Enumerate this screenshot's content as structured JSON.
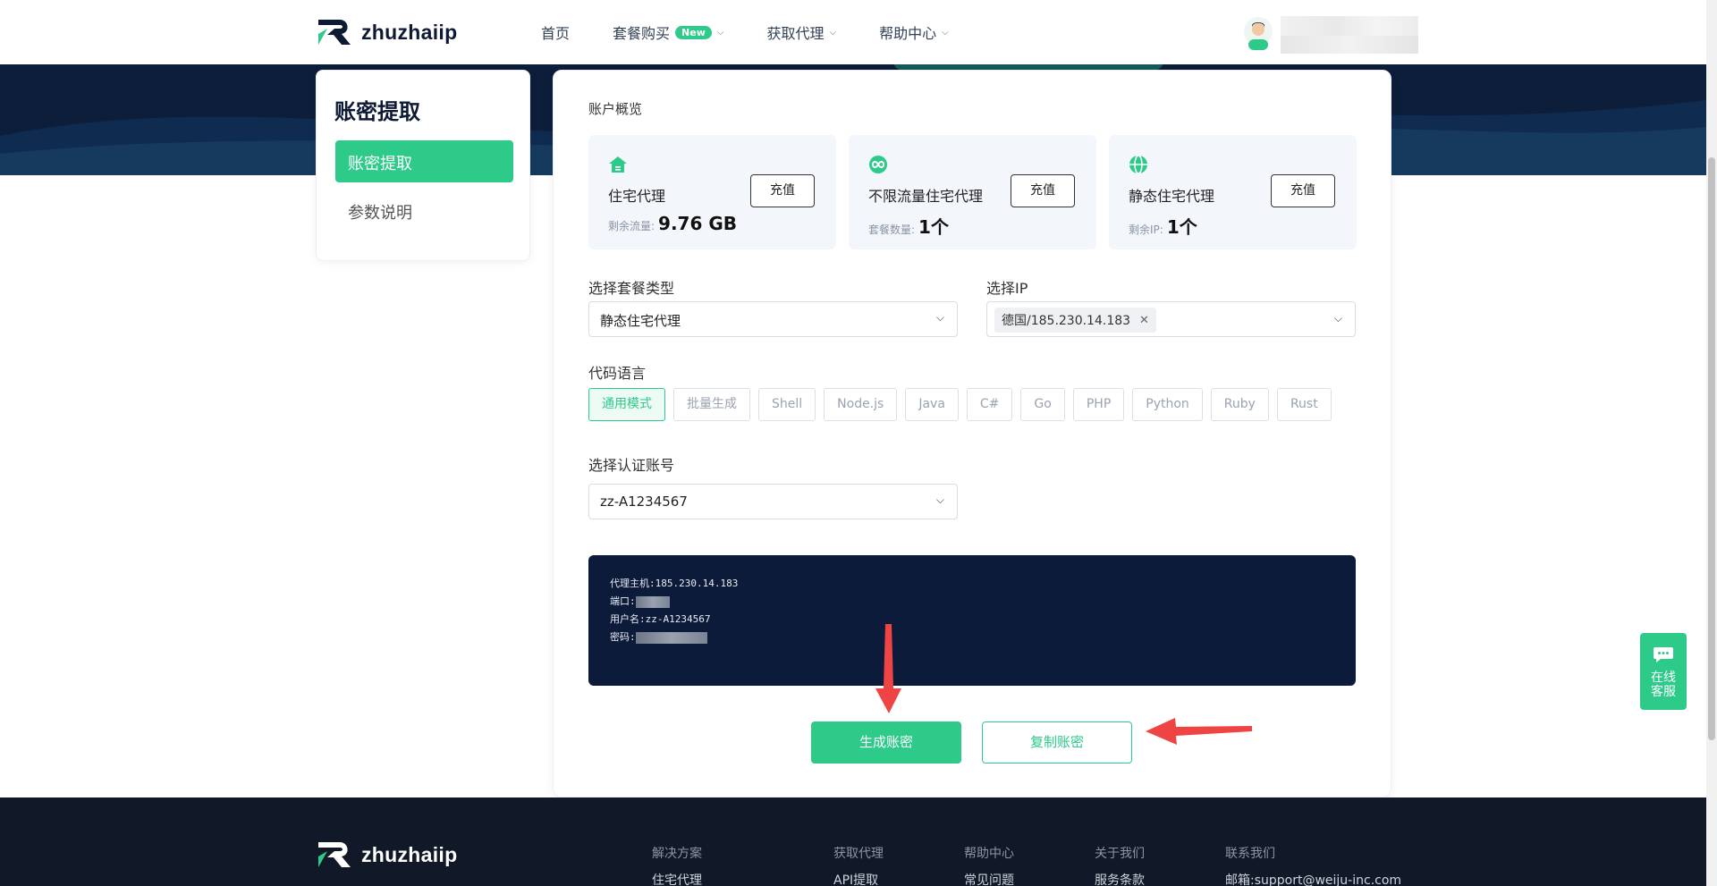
{
  "brand": {
    "name": "zhuzhaiip"
  },
  "nav": {
    "items": [
      {
        "label": "首页"
      },
      {
        "label": "套餐购买",
        "badge": "New"
      },
      {
        "label": "获取代理"
      },
      {
        "label": "帮助中心"
      }
    ]
  },
  "sidebar": {
    "title": "账密提取",
    "items": [
      {
        "label": "账密提取",
        "active": true
      },
      {
        "label": "参数说明",
        "active": false
      }
    ]
  },
  "overview": {
    "label": "账户概览",
    "cards": [
      {
        "name": "住宅代理",
        "sub_label": "剩余流量:",
        "value": "9.76 GB",
        "button": "充值",
        "icon": "home-icon"
      },
      {
        "name": "不限流量住宅代理",
        "sub_label": "套餐数量:",
        "value": "1个",
        "button": "充值",
        "icon": "infinity-icon"
      },
      {
        "name": "静态住宅代理",
        "sub_label": "剩余IP:",
        "value": "1个",
        "button": "充值",
        "icon": "globe-icon"
      }
    ]
  },
  "form": {
    "package_label": "选择套餐类型",
    "package_value": "静态住宅代理",
    "ip_label": "选择IP",
    "ip_tag": "德国/185.230.14.183",
    "lang_label": "代码语言",
    "languages": [
      "通用模式",
      "批量生成",
      "Shell",
      "Node.js",
      "Java",
      "C#",
      "Go",
      "PHP",
      "Python",
      "Ruby",
      "Rust"
    ],
    "active_language": "通用模式",
    "account_label": "选择认证账号",
    "account_value": "zz-A1234567"
  },
  "output": {
    "host_label": "代理主机:",
    "host_value": "185.230.14.183",
    "port_label": "端口:",
    "user_label": "用户名:",
    "user_value": "zz-A1234567",
    "pass_label": "密码:"
  },
  "actions": {
    "generate": "生成账密",
    "copy": "复制账密"
  },
  "footer": {
    "columns": [
      {
        "title": "解决方案",
        "link": "住宅代理"
      },
      {
        "title": "获取代理",
        "link": "API提取"
      },
      {
        "title": "帮助中心",
        "link": "常见问题"
      },
      {
        "title": "关于我们",
        "link": "服务条款"
      },
      {
        "title": "联系我们",
        "link": "邮箱:support@weiju-inc.com"
      }
    ]
  },
  "chat": {
    "label": "在线客服"
  },
  "colors": {
    "accent": "#2dca8a",
    "dark": "#0d1b3a",
    "annotation_arrow": "#ef4444"
  }
}
